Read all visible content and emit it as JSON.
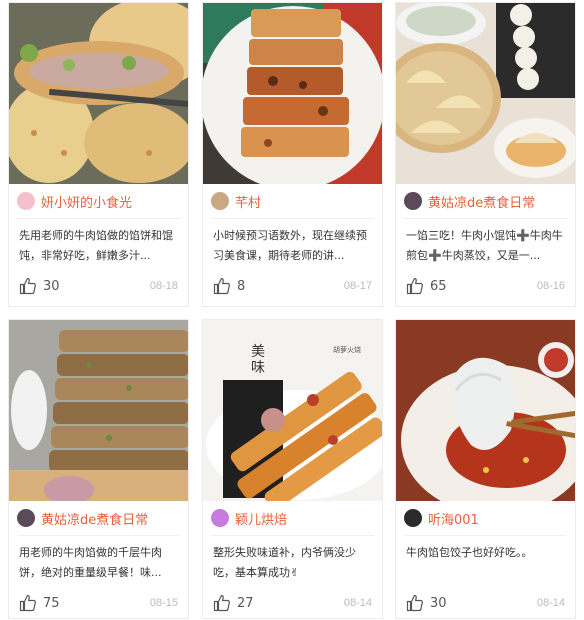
{
  "cards": [
    {
      "author": "妍小妍的小食光",
      "desc": "先用老师的牛肉馅做的馅饼和馄饨，非常好吃，鲜嫩多汁...",
      "likes": "30",
      "date": "08-18",
      "avatar_color": "#f3c0cc"
    },
    {
      "author": "芊村",
      "desc": "小时候预习语数外，现在继续预习美食课，期待老师的讲...",
      "likes": "8",
      "date": "08-17",
      "avatar_color": "#c9a886"
    },
    {
      "author": "黄姑凉de煮食日常",
      "desc": "一馅三吃！牛肉小馄饨➕牛肉牛煎包➕牛肉蒸饺，又是一...",
      "likes": "65",
      "date": "08-16",
      "avatar_color": "#5a4a5a"
    },
    {
      "author": "黄姑凉de煮食日常",
      "desc": "用老师的牛肉馅做的千层牛肉饼，绝对的重量级早餐！味...",
      "likes": "75",
      "date": "08-15",
      "avatar_color": "#5a4a5a"
    },
    {
      "author": "颖儿烘焙",
      "desc": "整形失败味道补，内爷俩没少吃，基本算成功✌",
      "likes": "27",
      "date": "08-14",
      "avatar_color": "#c77be0"
    },
    {
      "author": "听海001",
      "desc": "牛肉馅包饺子也好好吃。。",
      "likes": "30",
      "date": "08-14",
      "avatar_color": "#2b2b2b"
    }
  ],
  "photo_text": {
    "card5_title_a": "美",
    "card5_title_b": "味",
    "card5_small": "胡萝火烧"
  },
  "colors": {
    "author": "#e8603c",
    "date": "#bbbbbb"
  }
}
